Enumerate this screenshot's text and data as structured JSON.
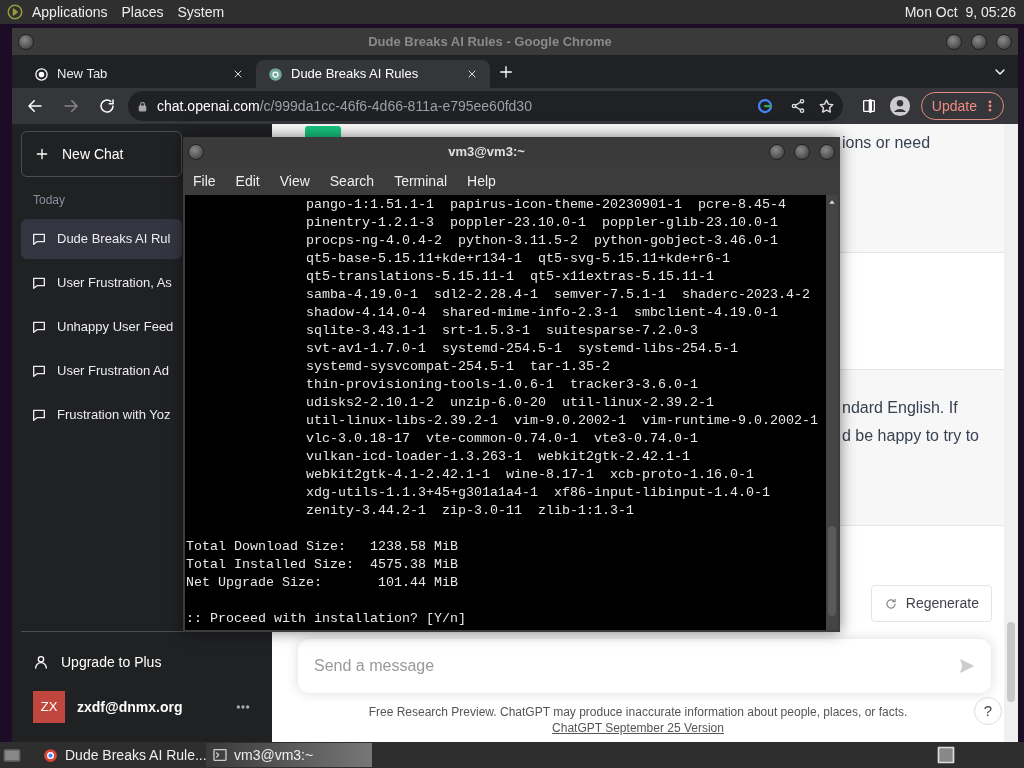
{
  "top_panel": {
    "menus": [
      "Applications",
      "Places",
      "System"
    ],
    "clock": "Mon Oct  9, 05:26"
  },
  "browser": {
    "title": "Dude Breaks AI Rules - Google Chrome",
    "tabs": [
      {
        "label": "New Tab",
        "selected": false
      },
      {
        "label": "Dude Breaks AI Rules",
        "selected": true
      }
    ],
    "url_host": "chat.openai.com",
    "url_path": "/c/999da1cc-46f6-4d66-811a-e795ee60fd30",
    "update_button": "Update"
  },
  "sidebar": {
    "new_chat": "New Chat",
    "section": "Today",
    "items": [
      {
        "label": "Dude Breaks AI Rul",
        "selected": true
      },
      {
        "label": "User Frustration, As",
        "selected": false
      },
      {
        "label": "Unhappy User Feed",
        "selected": false
      },
      {
        "label": "User Frustration Ad",
        "selected": false
      },
      {
        "label": "Frustration with Yoz",
        "selected": false
      }
    ],
    "upgrade": "Upgrade to Plus",
    "user": {
      "initials": "ZX",
      "email": "zxdf@dnmx.org"
    }
  },
  "chat": {
    "fragments": [
      {
        "lines": [
          "ions or need"
        ]
      },
      {
        "lines": [
          "ndard English. If",
          "d be happy to try to"
        ]
      }
    ],
    "regenerate": "Regenerate",
    "composer": {
      "placeholder": "Send a message"
    },
    "footer": "Free Research Preview. ChatGPT may produce inaccurate information about people, places, or facts.",
    "footer_link": "ChatGPT September 25 Version",
    "help": "?"
  },
  "terminal": {
    "title": "vm3@vm3:~",
    "menus": [
      "File",
      "Edit",
      "View",
      "Search",
      "Terminal",
      "Help"
    ],
    "packages": [
      "pango-1:1.51.1-1  papirus-icon-theme-20230901-1  pcre-8.45-4",
      "pinentry-1.2.1-3  poppler-23.10.0-1  poppler-glib-23.10.0-1",
      "procps-ng-4.0.4-2  python-3.11.5-2  python-gobject-3.46.0-1",
      "qt5-base-5.15.11+kde+r134-1  qt5-svg-5.15.11+kde+r6-1",
      "qt5-translations-5.15.11-1  qt5-x11extras-5.15.11-1",
      "samba-4.19.0-1  sdl2-2.28.4-1  semver-7.5.1-1  shaderc-2023.4-2",
      "shadow-4.14.0-4  shared-mime-info-2.3-1  smbclient-4.19.0-1",
      "sqlite-3.43.1-1  srt-1.5.3-1  suitesparse-7.2.0-3",
      "svt-av1-1.7.0-1  systemd-254.5-1  systemd-libs-254.5-1",
      "systemd-sysvcompat-254.5-1  tar-1.35-2",
      "thin-provisioning-tools-1.0.6-1  tracker3-3.6.0-1",
      "udisks2-2.10.1-2  unzip-6.0-20  util-linux-2.39.2-1",
      "util-linux-libs-2.39.2-1  vim-9.0.2002-1  vim-runtime-9.0.2002-1",
      "vlc-3.0.18-17  vte-common-0.74.0-1  vte3-0.74.0-1",
      "vulkan-icd-loader-1.3.263-1  webkit2gtk-2.42.1-1",
      "webkit2gtk-4.1-2.42.1-1  wine-8.17-1  xcb-proto-1.16.0-1",
      "xdg-utils-1.1.3+45+g301a1a4-1  xf86-input-libinput-1.4.0-1",
      "zenity-3.44.2-1  zip-3.0-11  zlib-1:1.3-1"
    ],
    "summary": [
      "Total Download Size:   1238.58 MiB",
      "Total Installed Size:  4575.38 MiB",
      "Net Upgrade Size:       101.44 MiB"
    ],
    "prompt": ":: Proceed with installation? [Y/n]"
  },
  "taskbar": {
    "items": [
      {
        "label": "Dude Breaks AI Rule...",
        "kind": "browser",
        "selected": false
      },
      {
        "label": "vm3@vm3:~",
        "kind": "terminal",
        "selected": true
      }
    ]
  }
}
